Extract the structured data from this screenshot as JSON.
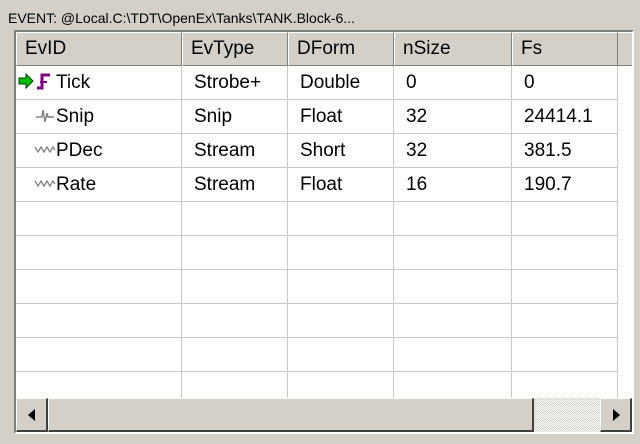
{
  "title": "EVENT: @Local.C:\\TDT\\OpenEx\\Tanks\\TANK.Block-6...",
  "columns": [
    "EvID",
    "EvType",
    "DForm",
    "nSize",
    "Fs"
  ],
  "rows": [
    {
      "icon": "strobe-icon",
      "selected": true,
      "evid": "Tick",
      "evtype": "Strobe+",
      "dform": "Double",
      "nsize": "0",
      "fs": "0"
    },
    {
      "icon": "snip-icon",
      "selected": false,
      "evid": "Snip",
      "evtype": "Snip",
      "dform": "Float",
      "nsize": "32",
      "fs": "24414.1"
    },
    {
      "icon": "stream-icon",
      "selected": false,
      "evid": "PDec",
      "evtype": "Stream",
      "dform": "Short",
      "nsize": "32",
      "fs": "381.5"
    },
    {
      "icon": "stream-icon",
      "selected": false,
      "evid": "Rate",
      "evtype": "Stream",
      "dform": "Float",
      "nsize": "16",
      "fs": "190.7"
    }
  ],
  "empty_rows": 6,
  "colors": {
    "strobe_icon": "#800080",
    "current_row_arrow": "#00c000",
    "grid_line": "#c8c8c8",
    "window_bg": "#d4d0c8"
  },
  "scrollbar": {
    "position_fraction": 0.0,
    "visible_fraction": 0.88
  }
}
